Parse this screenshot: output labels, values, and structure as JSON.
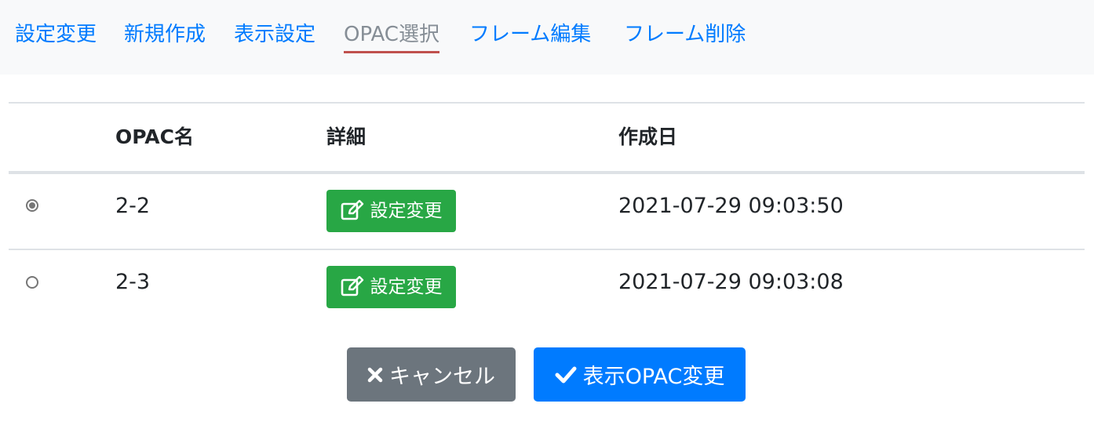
{
  "nav": {
    "tabs": [
      {
        "label": "設定変更",
        "active": false
      },
      {
        "label": "新規作成",
        "active": false
      },
      {
        "label": "表示設定",
        "active": false
      },
      {
        "label": "OPAC選択",
        "active": true
      },
      {
        "label": "フレーム編集",
        "active": false
      },
      {
        "label": "フレーム削除",
        "active": false
      }
    ]
  },
  "table": {
    "headers": {
      "name": "OPAC名",
      "detail": "詳細",
      "created": "作成日"
    },
    "rows": [
      {
        "selected": true,
        "name": "2-2",
        "edit_label": "設定変更",
        "created": "2021-07-29 09:03:50"
      },
      {
        "selected": false,
        "name": "2-3",
        "edit_label": "設定変更",
        "created": "2021-07-29 09:03:08"
      }
    ]
  },
  "footer": {
    "cancel_label": "キャンセル",
    "apply_label": "表示OPAC変更"
  },
  "colors": {
    "link": "#007bff",
    "active_tab_text": "#868e96",
    "active_underline": "#c0504d",
    "edit_button": "#28a745",
    "cancel_button": "#6c757d",
    "apply_button": "#007bff"
  },
  "icons": {
    "edit": "pencil-square-icon",
    "cancel": "times-icon",
    "apply": "check-icon"
  }
}
